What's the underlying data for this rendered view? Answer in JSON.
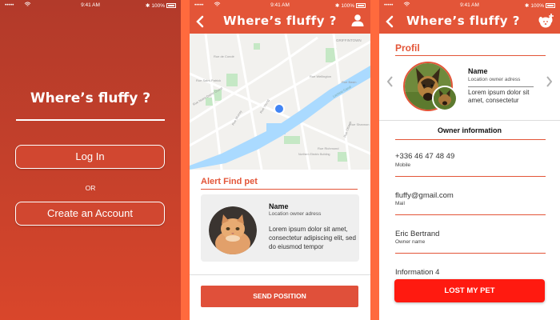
{
  "status": {
    "carrier": "•••••",
    "time": "9:41 AM",
    "battery": "100%"
  },
  "app_title": "Where’s fluffy ?",
  "login": {
    "login_label": "Log In",
    "or_label": "OR",
    "create_label": "Create an Account"
  },
  "map": {
    "labels": [
      "GRIFFINTOWN",
      "Rue Wellington",
      "Rue Basin",
      "Lachine Canal",
      "Rue Notre-Dame Ouest",
      "Rue de Condé",
      "Rue Saint-Patrick",
      "Northern Electric Building",
      "Rue Richmond",
      "Rue Young",
      "Rue Murray",
      "Rue Ottawa",
      "Rue Shannon"
    ],
    "road_color": "#ffffff",
    "water_color": "#aadaff",
    "park_color": "#c5e8c5",
    "pin_color": "#4285f4"
  },
  "alert": {
    "title": "Alert Find pet",
    "name": "Name",
    "subtitle": "Location owner adress",
    "text": "Lorem ipsum dolor sit amet, consectetur adipiscing elit, sed do eiusmod tempor",
    "send_label": "SEND POSITION"
  },
  "profile": {
    "title": "Profil",
    "name": "Name",
    "subtitle": "Location owner adress",
    "text": "Lorem ipsum dolor sit amet, consectetur",
    "owner_header": "Owner information",
    "fields": [
      {
        "value": "+336 46 47 48 49",
        "label": "Mobile"
      },
      {
        "value": "fluffy@gmail.com",
        "label": "Mail"
      },
      {
        "value": "Eric Bertrand",
        "label": "Owner name"
      },
      {
        "value": "Information 4",
        "label": ""
      }
    ],
    "lost_label": "LOST MY PET"
  },
  "colors": {
    "accent": "#e35538",
    "outer_background": "#ff6a3d",
    "login_gradient_top": "#b23a2a",
    "login_gradient_bottom": "#d9462b",
    "send_button": "#e0503a",
    "lost_button": "#ff1a10"
  },
  "icons": {
    "back": "chevron-left-icon",
    "user": "user-icon",
    "add_pet": "dog-plus-icon",
    "wifi": "wifi-icon",
    "bluetooth": "bluetooth-icon",
    "battery": "battery-icon",
    "location_pin": "location-pin-icon",
    "carousel_prev": "chevron-left-icon",
    "carousel_next": "chevron-right-icon"
  }
}
